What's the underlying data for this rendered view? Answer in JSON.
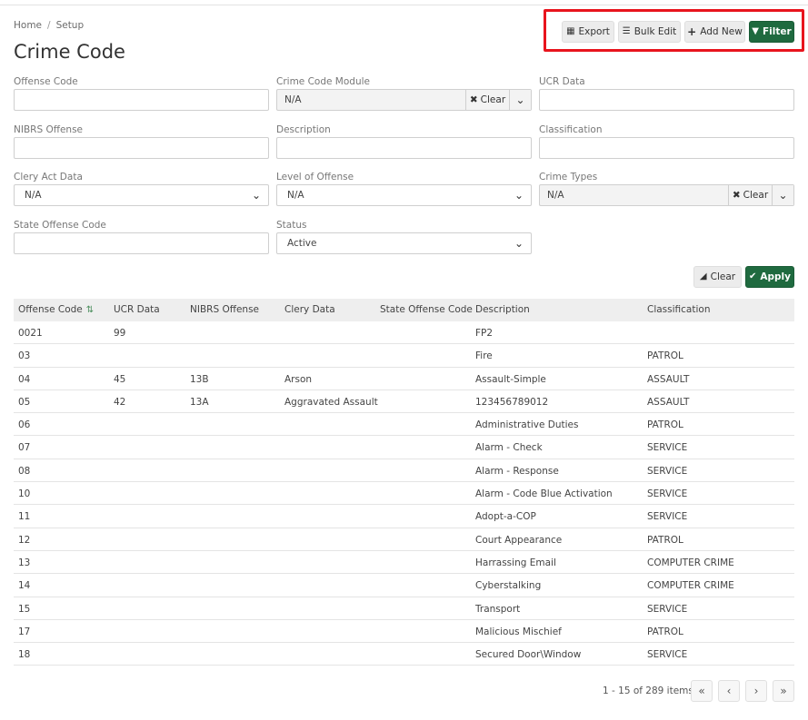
{
  "breadcrumb": {
    "home": "Home",
    "separator": "/",
    "current": "Setup"
  },
  "page_title": "Crime Code",
  "toolbar": {
    "export_label": "Export",
    "bulk_edit_label": "Bulk Edit",
    "add_new_label": "Add New",
    "filter_label": "Filter"
  },
  "filters": {
    "offense_code": {
      "label": "Offense Code",
      "value": ""
    },
    "crime_code_module": {
      "label": "Crime Code Module",
      "value": "N/A",
      "clear_label": "Clear"
    },
    "ucr_data": {
      "label": "UCR Data",
      "value": ""
    },
    "nibrs_offense": {
      "label": "NIBRS Offense",
      "value": ""
    },
    "description": {
      "label": "Description",
      "value": ""
    },
    "classification": {
      "label": "Classification",
      "value": ""
    },
    "clery_act_data": {
      "label": "Clery Act Data",
      "value": "N/A"
    },
    "level_of_offense": {
      "label": "Level of Offense",
      "value": "N/A"
    },
    "crime_types": {
      "label": "Crime Types",
      "value": "N/A",
      "clear_label": "Clear"
    },
    "state_offense_code": {
      "label": "State Offense Code",
      "value": ""
    },
    "status": {
      "label": "Status",
      "value": "Active"
    }
  },
  "filter_actions": {
    "clear_label": "Clear",
    "apply_label": "Apply"
  },
  "table": {
    "headers": [
      "Offense Code",
      "UCR Data",
      "NIBRS Offense",
      "Clery Data",
      "State Offense Code",
      "Description",
      "Classification"
    ],
    "rows": [
      [
        "0021",
        "99",
        "",
        "",
        "",
        "FP2",
        ""
      ],
      [
        "03",
        "",
        "",
        "",
        "",
        "Fire",
        "PATROL"
      ],
      [
        "04",
        "45",
        "13B",
        "Arson",
        "",
        "Assault-Simple",
        "ASSAULT"
      ],
      [
        "05",
        "42",
        "13A",
        "Aggravated Assault",
        "",
        "123456789012",
        "ASSAULT"
      ],
      [
        "06",
        "",
        "",
        "",
        "",
        "Administrative Duties",
        "PATROL"
      ],
      [
        "07",
        "",
        "",
        "",
        "",
        "Alarm - Check",
        "SERVICE"
      ],
      [
        "08",
        "",
        "",
        "",
        "",
        "Alarm - Response",
        "SERVICE"
      ],
      [
        "10",
        "",
        "",
        "",
        "",
        "Alarm - Code Blue Activation",
        "SERVICE"
      ],
      [
        "11",
        "",
        "",
        "",
        "",
        "Adopt-a-COP",
        "SERVICE"
      ],
      [
        "12",
        "",
        "",
        "",
        "",
        "Court Appearance",
        "PATROL"
      ],
      [
        "13",
        "",
        "",
        "",
        "",
        "Harrassing Email",
        "COMPUTER CRIME"
      ],
      [
        "14",
        "",
        "",
        "",
        "",
        "Cyberstalking",
        "COMPUTER CRIME"
      ],
      [
        "15",
        "",
        "",
        "",
        "",
        "Transport",
        "SERVICE"
      ],
      [
        "17",
        "",
        "",
        "",
        "",
        "Malicious Mischief",
        "PATROL"
      ],
      [
        "18",
        "",
        "",
        "",
        "",
        "Secured Door\\Window",
        "SERVICE"
      ]
    ]
  },
  "pagination": {
    "info": "1 - 15 of 289 items"
  },
  "colors": {
    "primary_green": "#1f6a3f",
    "highlight_red": "#e8141d"
  },
  "icons": {
    "export": "table-icon",
    "bulk_edit": "list-icon",
    "add_new": "plus-icon",
    "filter": "filter-icon",
    "clear": "eraser-icon",
    "apply": "check-icon",
    "sort": "sort-ascending-icon"
  }
}
